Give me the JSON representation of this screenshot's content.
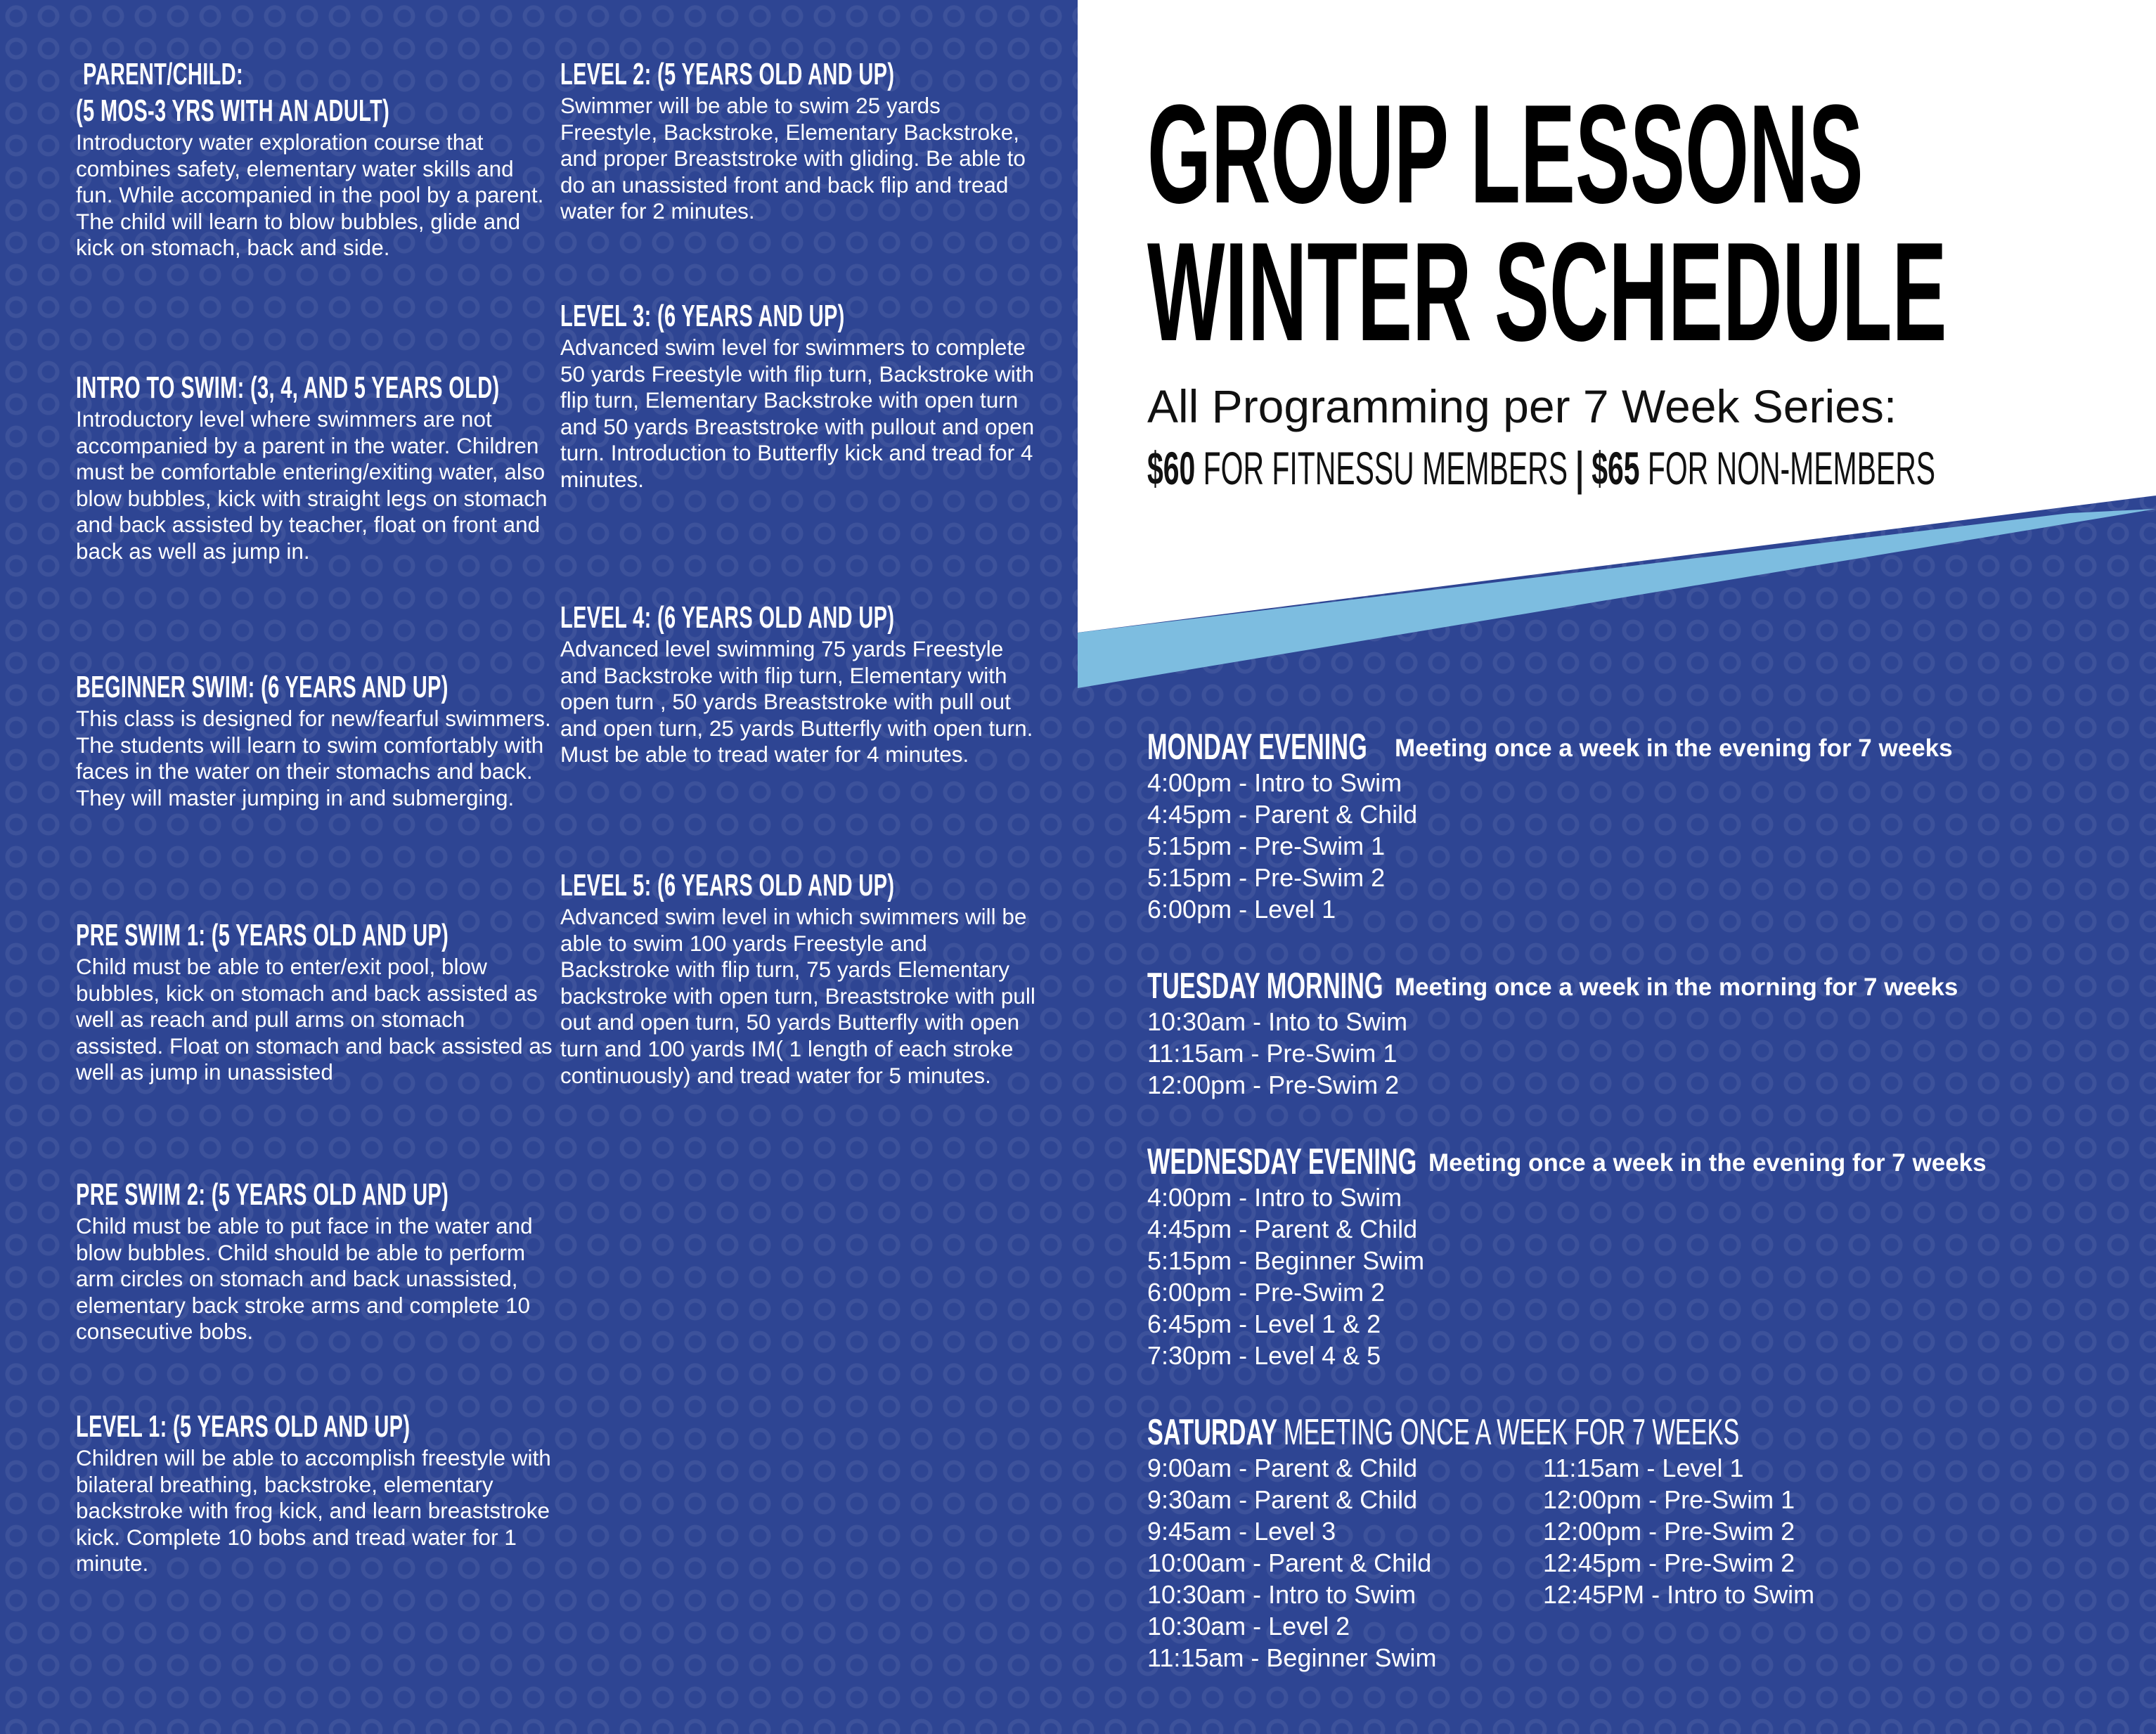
{
  "left_column": [
    {
      "title": "PARENT/CHILD:",
      "subtitle": "(5 MOS-3 YRS WITH AN ADULT)",
      "text": "Introductory water exploration course that combines safety, elementary water skills and fun. While accompanied in the pool by a parent. The child will learn to blow bubbles, glide and kick on stomach, back and side."
    },
    {
      "title": "INTRO TO SWIM: (3, 4, AND 5 YEARS OLD)",
      "text": "Introductory level where swimmers are not accompanied by a parent in the water. Children must be comfortable entering/exiting water, also blow bubbles, kick with straight legs on stomach and back assisted by teacher, float on front and back as well as jump in."
    },
    {
      "title": "BEGINNER SWIM: (6 YEARS AND UP)",
      "text": "This class is designed for new/fearful swimmers. The students will learn to swim comfortably with faces in the water on their stomachs and back. They will master jumping in and submerging."
    },
    {
      "title": "PRE SWIM 1: (5 YEARS OLD AND UP)",
      "text": "Child must be able to enter/exit pool, blow bubbles, kick on stomach and back assisted as well as reach and pull arms on stomach assisted. Float on stomach and back assisted as well as jump in unassisted"
    },
    {
      "title": "PRE SWIM 2: (5 YEARS OLD AND UP)",
      "text": "Child must be able to put face in the water and blow bubbles. Child should be able to perform arm circles on stomach and back unassisted, elementary back stroke arms and complete 10 consecutive bobs."
    },
    {
      "title": "LEVEL 1: (5 YEARS OLD AND UP)",
      "text": "Children will be able to accomplish freestyle with bilateral breathing, backstroke, elementary backstroke with frog kick, and learn breaststroke kick. Complete 10 bobs and tread water for 1 minute."
    }
  ],
  "middle_column": [
    {
      "title": "LEVEL 2: (5 YEARS OLD AND UP)",
      "text": "Swimmer will be able to swim 25 yards Freestyle, Backstroke, Elementary Backstroke, and proper Breaststroke with gliding. Be able to do an unassisted front and back flip and tread water for 2 minutes."
    },
    {
      "title": "LEVEL 3: (6 YEARS AND UP)",
      "text": "Advanced swim level for swimmers to complete 50 yards Freestyle with flip turn, Backstroke with flip turn, Elementary Backstroke with open turn and 50 yards Breaststroke with pullout and open turn. Introduction to Butterfly kick and tread for 4 minutes."
    },
    {
      "title": "LEVEL 4: (6 YEARS OLD AND UP)",
      "text": "Advanced level swimming 75 yards Freestyle and Backstroke with flip turn, Elementary with open turn , 50 yards Breaststroke with pull out and open turn, 25 yards Butterfly with open turn. Must be able to tread water for 4 minutes."
    },
    {
      "title": "LEVEL 5: (6 YEARS OLD AND UP)",
      "text": "Advanced swim level in which swimmers will be able to swim 100 yards Freestyle and Backstroke with flip turn, 75 yards Elementary backstroke with open turn, Breaststroke with pull out and open turn, 50 yards Butterfly with open turn and 100 yards IM( 1 length of each stroke continuously) and tread water for 5 minutes."
    }
  ],
  "header": {
    "title_line1": "GROUP LESSONS",
    "title_line2": "WINTER SCHEDULE",
    "subtitle": "All Programming per 7 Week Series:",
    "member_price": "$60",
    "member_label": "FOR FITNESSU MEMBERS",
    "separator": "|",
    "nonmember_price": "$65",
    "nonmember_label": "FOR NON-MEMBERS"
  },
  "schedule": {
    "monday": {
      "day": "MONDAY EVENING",
      "note": "Meeting once a week in the evening for 7 weeks",
      "items": [
        "4:00pm - Intro to Swim",
        "4:45pm - Parent & Child",
        "5:15pm - Pre-Swim 1",
        "5:15pm - Pre-Swim 2",
        "6:00pm - Level 1"
      ]
    },
    "tuesday": {
      "day": "TUESDAY MORNING",
      "note": "Meeting once a week in the morning for 7 weeks",
      "items": [
        "10:30am - Into to Swim",
        "11:15am - Pre-Swim 1",
        "12:00pm - Pre-Swim 2"
      ]
    },
    "wednesday": {
      "day": "WEDNESDAY EVENING",
      "note": "Meeting once a week in the evening for 7 weeks",
      "items": [
        "4:00pm - Intro to Swim",
        "4:45pm - Parent & Child",
        "5:15pm - Beginner Swim",
        "6:00pm - Pre-Swim 2",
        "6:45pm - Level 1 & 2",
        "7:30pm - Level 4 & 5"
      ]
    },
    "saturday": {
      "day": "SATURDAY",
      "note": "MEETING ONCE A WEEK FOR 7 WEEKS",
      "col1": [
        "9:00am - Parent & Child",
        "9:30am - Parent & Child",
        "9:45am - Level 3",
        "10:00am - Parent & Child",
        "10:30am - Intro to Swim",
        "10:30am - Level 2",
        "11:15am - Beginner Swim"
      ],
      "col2": [
        "11:15am - Level 1",
        "12:00pm - Pre-Swim 1",
        "12:00pm - Pre-Swim 2",
        "12:45pm - Pre-Swim 2",
        "12:45PM - Intro to Swim"
      ]
    }
  }
}
